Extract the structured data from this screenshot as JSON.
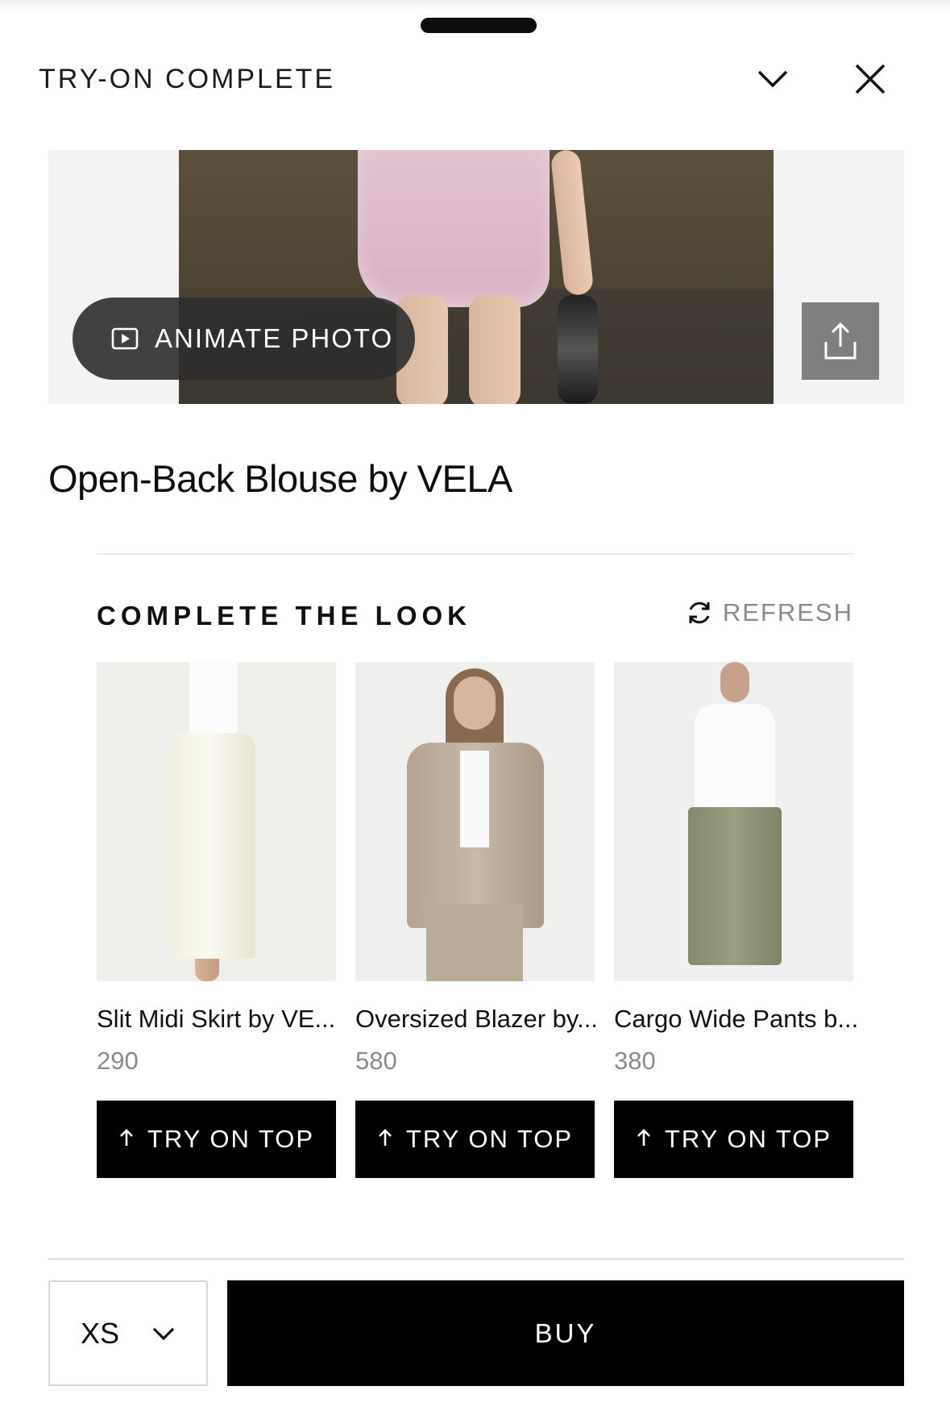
{
  "header": {
    "title": "TRY-ON COMPLETE"
  },
  "hero": {
    "animate_label": "ANIMATE PHOTO"
  },
  "product": {
    "title": "Open-Back Blouse by VELA"
  },
  "complete_look": {
    "heading": "COMPLETE THE LOOK",
    "refresh_label": "REFRESH",
    "items": [
      {
        "name": "Slit Midi Skirt by VE...",
        "price": "290",
        "button_label": "TRY ON TOP"
      },
      {
        "name": "Oversized Blazer by...",
        "price": "580",
        "button_label": "TRY ON TOP"
      },
      {
        "name": "Cargo Wide Pants b...",
        "price": "380",
        "button_label": "TRY ON TOP"
      }
    ]
  },
  "footer": {
    "size_value": "XS",
    "buy_label": "BUY"
  },
  "icons": [
    "chevron-down-icon",
    "close-icon",
    "play-icon",
    "share-icon",
    "refresh-icon",
    "arrow-up-icon"
  ],
  "colors": {
    "primary": "#000000",
    "muted": "#8a8a8a",
    "hero_bg": "#f3f3f3"
  }
}
